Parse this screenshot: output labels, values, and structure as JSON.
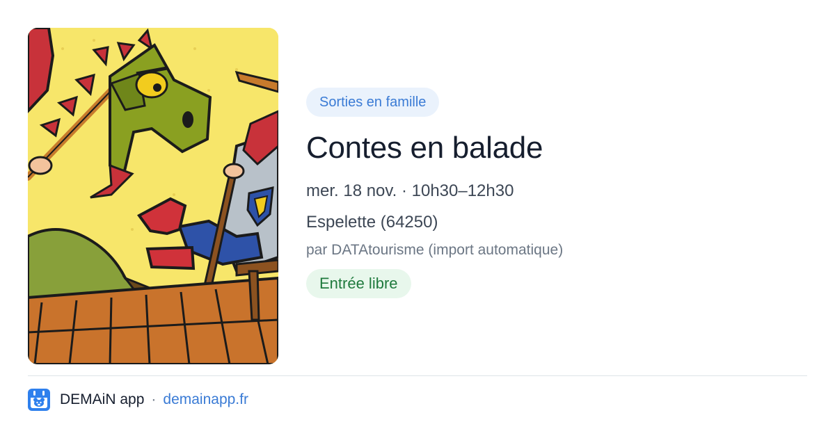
{
  "event": {
    "image_alt": "Illustration: dragon and knight",
    "category": "Sorties en famille",
    "title": "Contes en balade",
    "when": "mer. 18 nov. · 10h30–12h30",
    "where": "Espelette (64250)",
    "source": "par DATAtourisme (import automatique)",
    "price": "Entrée libre"
  },
  "footer": {
    "app_name": "DEMAiN app",
    "separator": "·",
    "link": "demainapp.fr",
    "logo_icon": "calendar-bear-icon"
  },
  "colors": {
    "accent_blue": "#3a7bd5",
    "category_bg": "#eaf2fc",
    "price_text": "#1f7a3d",
    "price_bg": "#e8f7ec",
    "title_text": "#161e2e"
  }
}
